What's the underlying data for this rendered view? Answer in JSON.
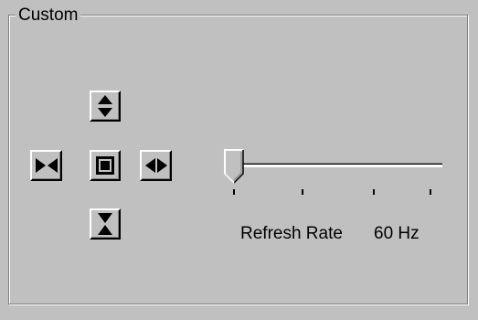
{
  "group": {
    "title": "Custom"
  },
  "position_buttons": {
    "move_vertical": "up-down-arrows-icon",
    "shrink_horizontal": "arrows-inward-icon",
    "center": "center-square-icon",
    "expand_horizontal": "left-right-arrows-icon",
    "shrink_vertical": "arrows-vertical-inward-icon"
  },
  "refresh": {
    "label": "Refresh Rate",
    "value_text": "60 Hz",
    "slider_position": 0,
    "tick_count": 4
  }
}
